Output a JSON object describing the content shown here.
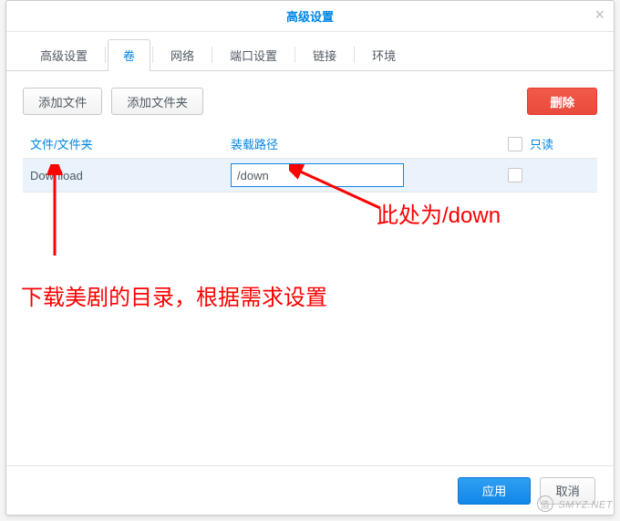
{
  "titlebar": {
    "title": "高级设置"
  },
  "tabs": {
    "items": [
      {
        "label": "高级设置"
      },
      {
        "label": "卷"
      },
      {
        "label": "网络"
      },
      {
        "label": "端口设置"
      },
      {
        "label": "链接"
      },
      {
        "label": "环境"
      }
    ],
    "active_index": 1
  },
  "toolbar": {
    "add_file_label": "添加文件",
    "add_folder_label": "添加文件夹",
    "delete_label": "删除"
  },
  "columns": {
    "file_folder": "文件/文件夹",
    "mount_path": "装载路径",
    "readonly": "只读"
  },
  "rows": [
    {
      "file_folder": "Download",
      "mount_path": "/down",
      "readonly": false
    }
  ],
  "footer": {
    "apply_label": "应用",
    "cancel_label": "取消"
  },
  "annotations": {
    "note1": "此处为/down",
    "note2": "下载美剧的目录，根据需求设置"
  },
  "watermark": "SMYZ.NET"
}
